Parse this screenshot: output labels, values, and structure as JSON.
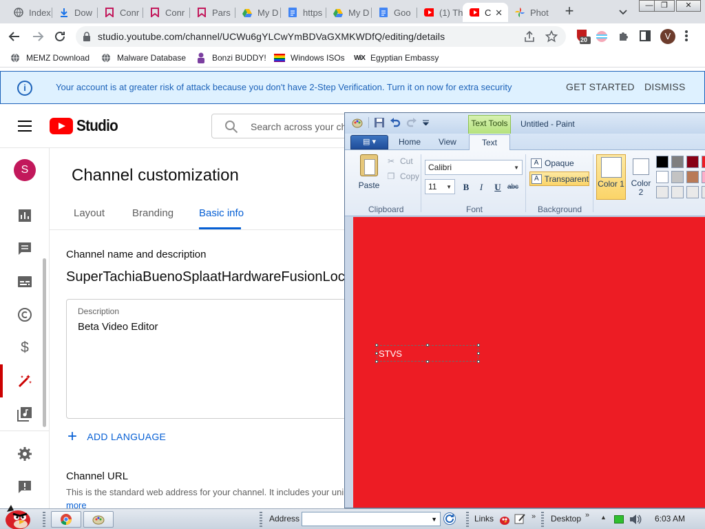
{
  "browser": {
    "tabs": [
      {
        "label": "Index",
        "icon": "globe-icon"
      },
      {
        "label": "Dow",
        "icon": "download-icon"
      },
      {
        "label": "Conr",
        "icon": "bookmark-icon"
      },
      {
        "label": "Conr",
        "icon": "bookmark-icon"
      },
      {
        "label": "Pars",
        "icon": "bookmark-icon"
      },
      {
        "label": "My D",
        "icon": "drive-icon"
      },
      {
        "label": "https",
        "icon": "docs-icon"
      },
      {
        "label": "My D",
        "icon": "drive-icon"
      },
      {
        "label": "Goo",
        "icon": "docs-icon"
      },
      {
        "label": "(1) Th",
        "icon": "youtube-icon"
      },
      {
        "label": "C",
        "icon": "youtube-icon",
        "active": true
      },
      {
        "label": "Phot",
        "icon": "photos-icon"
      }
    ],
    "url": "studio.youtube.com/channel/UCWu6gYLCwYmBDVaGXMKWDfQ/editing/details",
    "extension_badge": "20",
    "profile_initial": "V",
    "bookmarks": [
      {
        "label": "MEMZ Download",
        "icon": "globe-icon"
      },
      {
        "label": "Malware Database",
        "icon": "globe-icon"
      },
      {
        "label": "Bonzi BUDDY!",
        "icon": "bonzi-icon"
      },
      {
        "label": "Windows ISOs",
        "icon": "rainbow-flag-icon"
      },
      {
        "label": "Egyptian Embassy",
        "icon": "wix-icon"
      }
    ]
  },
  "banner": {
    "message": "Your account is at greater risk of attack because you don't have 2-Step Verification. Turn it on now for extra security",
    "get_started": "GET STARTED",
    "dismiss": "DISMISS"
  },
  "studio": {
    "logo_text": "Studio",
    "search_placeholder": "Search across your ch",
    "avatar_initial": "S",
    "page_title": "Channel customization",
    "tabs": [
      "Layout",
      "Branding",
      "Basic info"
    ],
    "active_tab": "Basic info",
    "section_name_desc": "Channel name and description",
    "channel_name": "SuperTachiaBuenoSplaatHardwareFusionLoc",
    "description_label": "Description",
    "description_value": "Beta Video Editor",
    "add_language": "ADD LANGUAGE",
    "channel_url_title": "Channel URL",
    "channel_url_desc": "This is the standard web address for your channel. It includes your uni",
    "more": "more"
  },
  "paint": {
    "context_tab": "Text Tools",
    "title": "Untitled - Paint",
    "ribbon_tabs": [
      "Home",
      "View",
      "Text"
    ],
    "active_ribbon_tab": "Text",
    "paste": "Paste",
    "cut": "Cut",
    "copy": "Copy",
    "group_clipboard": "Clipboard",
    "group_font": "Font",
    "group_background": "Background",
    "font_family": "Calibri",
    "font_size": "11",
    "bold": "B",
    "italic": "I",
    "underline": "U",
    "strike": "abc",
    "opaque": "Opaque",
    "transparent": "Transparent",
    "color1": "Color 1",
    "color2": "Color 2",
    "canvas_color": "#ed1c24",
    "canvas_text": "STVS",
    "palette": [
      "#000000",
      "#7f7f7f",
      "#880015",
      "#ed1c24",
      "#ffffff",
      "#c3c3c3",
      "#b97a57",
      "#ffaec9",
      "#e9e9e9",
      "#e9e9e9",
      "#e9e9e9",
      "#e9e9e9"
    ]
  },
  "taskbar": {
    "address_label": "Address",
    "links": "Links",
    "desktop": "Desktop",
    "clock": "6:03 AM"
  }
}
